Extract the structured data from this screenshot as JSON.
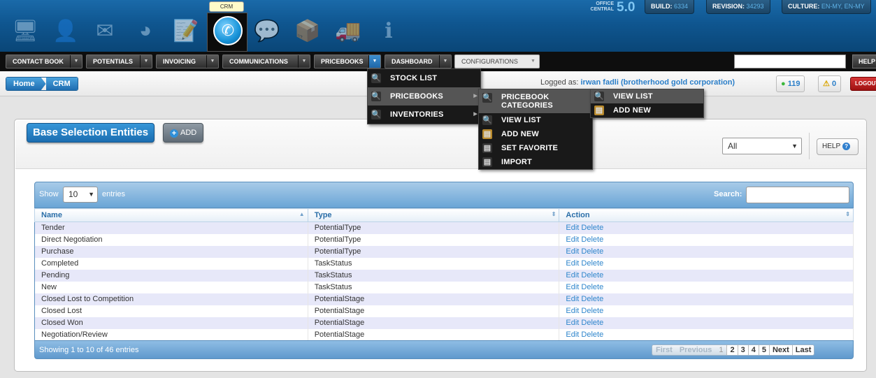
{
  "top_bar": {
    "active_app_tooltip": "CRM",
    "apps": [
      {
        "name": "desktop-icon",
        "glyph": "🖥"
      },
      {
        "name": "contacts-icon",
        "glyph": "👤"
      },
      {
        "name": "mail-icon",
        "glyph": "✉"
      },
      {
        "name": "pie-chart-icon",
        "glyph": "◕"
      },
      {
        "name": "document-icon",
        "glyph": "📝"
      },
      {
        "name": "phone-icon",
        "glyph": "✆"
      },
      {
        "name": "chat-icon",
        "glyph": "💬"
      },
      {
        "name": "box-icon",
        "glyph": "📦"
      },
      {
        "name": "truck-icon",
        "glyph": "🚚"
      },
      {
        "name": "info-icon",
        "glyph": "ℹ"
      }
    ],
    "product_label_1": "OFFICE",
    "product_label_2": "CENTRAL",
    "product_version": "5.0",
    "build_label": "BUILD:",
    "build_value": "6334",
    "revision_label": "REVISION:",
    "revision_value": "34293",
    "culture_label": "CULTURE:",
    "culture_value": "EN-MY, EN-MY"
  },
  "menu": {
    "items": [
      "CONTACT BOOK",
      "POTENTIALS",
      "INVOICING",
      "COMMUNICATIONS",
      "PRICEBOOKS",
      "DASHBOARD",
      "CONFIGURATIONS"
    ],
    "help": "HELP"
  },
  "breadcrumb": [
    "Home",
    "CRM"
  ],
  "session": {
    "logged_as_label": "Logged as:",
    "user": "irwan fadli (brotherhood gold corporation)",
    "online_count": "119",
    "alert_count": "0",
    "logout": "LOGOUT"
  },
  "dropdowns": {
    "pricebooks_menu": [
      "STOCK LIST",
      "PRICEBOOKS",
      "INVENTORIES"
    ],
    "pricebooks_submenu": [
      "PRICEBOOK CATEGORIES",
      "VIEW LIST",
      "ADD NEW",
      "SET FAVORITE",
      "IMPORT"
    ],
    "categories_submenu": [
      "VIEW LIST",
      "ADD NEW"
    ]
  },
  "panel": {
    "title": "Base Selection Entities",
    "add_label": "ADD",
    "filter_value": "All",
    "help_label": "HELP"
  },
  "table": {
    "show_label": "Show",
    "page_length": "10",
    "entries_label": "entries",
    "search_label": "Search:",
    "columns": [
      "Name",
      "Type",
      "Action"
    ],
    "rows": [
      {
        "name": "Tender",
        "type": "PotentialType"
      },
      {
        "name": "Direct Negotiation",
        "type": "PotentialType"
      },
      {
        "name": "Purchase",
        "type": "PotentialType"
      },
      {
        "name": "Completed",
        "type": "TaskStatus"
      },
      {
        "name": "Pending",
        "type": "TaskStatus"
      },
      {
        "name": "New",
        "type": "TaskStatus"
      },
      {
        "name": "Closed Lost to Competition",
        "type": "PotentialStage"
      },
      {
        "name": "Closed Lost",
        "type": "PotentialStage"
      },
      {
        "name": "Closed Won",
        "type": "PotentialStage"
      },
      {
        "name": "Negotiation/Review",
        "type": "PotentialStage"
      }
    ],
    "edit_label": "Edit",
    "delete_label": "Delete",
    "info": "Showing 1 to 10 of 46 entries",
    "pager": {
      "first": "First",
      "previous": "Previous",
      "pages": [
        "1",
        "2",
        "3",
        "4",
        "5"
      ],
      "next": "Next",
      "last": "Last"
    }
  },
  "colors": {
    "accent": "#1f6db0",
    "menu_bg": "#0e0e0e",
    "link": "#2f86cc"
  }
}
